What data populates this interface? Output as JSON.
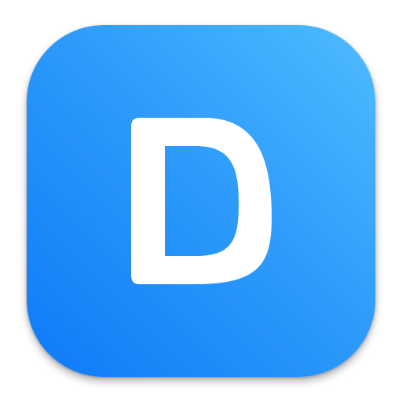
{
  "icon": {
    "glyph": "D",
    "glyph_color": "#ffffff",
    "gradient_colors": [
      "#4fbcff",
      "#2e9bfb",
      "#0e7af7"
    ]
  }
}
